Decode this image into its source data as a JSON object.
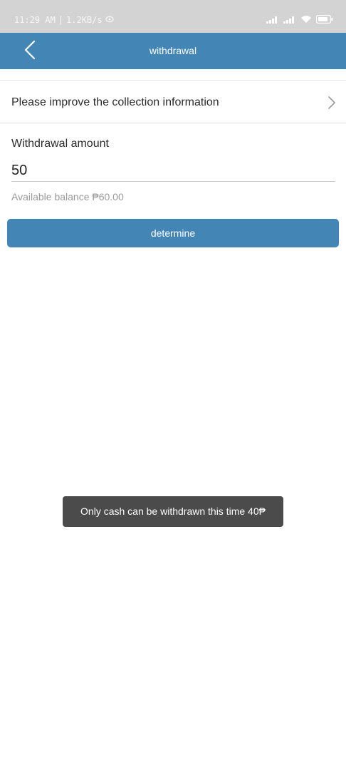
{
  "status_bar": {
    "time": "11:29 AM",
    "network_speed": "1.2KB/s",
    "icons": [
      "signal-icon",
      "signal-icon",
      "wifi-icon",
      "battery-icon"
    ]
  },
  "header": {
    "title": "withdrawal",
    "back_icon": "chevron-left-icon",
    "color": "#4386b5"
  },
  "collection_info": {
    "label": "Please improve the collection information",
    "icon": "chevron-right-icon"
  },
  "withdrawal": {
    "amount_label": "Withdrawal amount",
    "amount_value": "50",
    "balance_text": "Available balance ₱60.00"
  },
  "actions": {
    "determine_label": "determine"
  },
  "toast": {
    "message": "Only cash can be withdrawn this time 40₱"
  }
}
